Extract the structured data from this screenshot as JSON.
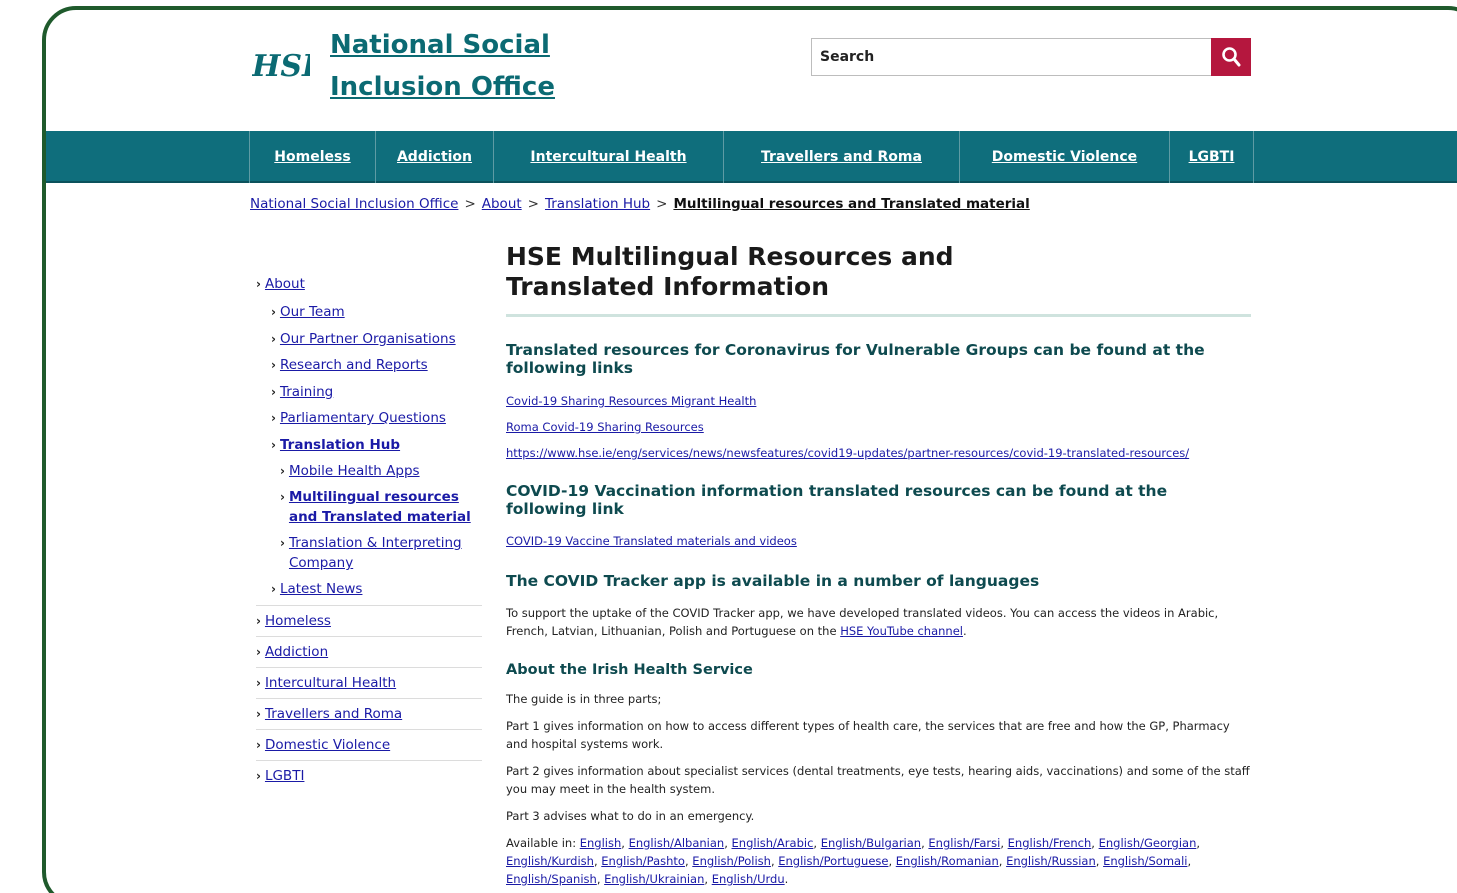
{
  "header": {
    "logo_text": "HSE",
    "site_title_line1": "National Social",
    "site_title_line2": "Inclusion Office",
    "search_placeholder": "Search",
    "search_icon": "search-icon"
  },
  "nav": [
    {
      "label": "Homeless"
    },
    {
      "label": "Addiction"
    },
    {
      "label": "Intercultural Health"
    },
    {
      "label": "Travellers and Roma"
    },
    {
      "label": "Domestic Violence"
    },
    {
      "label": "LGBTI"
    }
  ],
  "breadcrumb": {
    "items": [
      "National Social Inclusion Office",
      "About",
      "Translation Hub"
    ],
    "current": "Multilingual resources and Translated material",
    "separator": ">"
  },
  "sidebar": {
    "about": "About",
    "about_children": [
      "Our Team",
      "Our Partner Organisations",
      "Research and Reports",
      "Training",
      "Parliamentary Questions",
      "Translation Hub"
    ],
    "hub_children": [
      "Mobile Health Apps",
      "Multilingual resources and Translated material",
      "Translation & Interpreting Company"
    ],
    "latest_news": "Latest News",
    "main_items": [
      "Homeless",
      "Addiction",
      "Intercultural Health",
      "Travellers and Roma",
      "Domestic Violence",
      "LGBTI"
    ]
  },
  "content": {
    "title_line1": "HSE Multilingual Resources and",
    "title_line2": "Translated Information",
    "sec1_heading": "Translated resources for Coronavirus for Vulnerable Groups can be found at the following links",
    "sec1_links": [
      "Covid-19 Sharing Resources Migrant Health",
      "Roma Covid-19 Sharing Resources",
      "https://www.hse.ie/eng/services/news/newsfeatures/covid19-updates/partner-resources/covid-19-translated-resources/"
    ],
    "sec2_heading": "COVID-19 Vaccination information translated resources can be found at the following link",
    "sec2_link": "COVID-19 Vaccine Translated materials and videos",
    "sec3_heading": "The COVID Tracker app is available in a number of languages",
    "sec3_text": "To support the uptake of the COVID Tracker app, we have developed translated videos. You can access the videos in Arabic, French, Latvian, Lithuanian, Polish and Portuguese on the",
    "sec3_link": "HSE YouTube channel",
    "sec4_heading": "About the Irish Health Service",
    "sec4_p1": "The guide is in three parts;",
    "sec4_p2": "Part 1 gives information on how to access different types of health care, the services that are free and how the GP, Pharmacy and hospital systems work.",
    "sec4_p3": "Part 2 gives information about specialist services (dental treatments, eye tests, hearing aids, vaccinations) and some of the staff you may meet in the health system.",
    "sec4_p4": "Part 3 advises what to do in an emergency.",
    "available_label": "Available in:",
    "languages": [
      "English",
      "English/Albanian",
      "English/Arabic",
      "English/Bulgarian",
      "English/Farsi",
      "English/French",
      "English/Georgian",
      "English/Kurdish",
      "English/Pashto",
      "English/Polish",
      "English/Portuguese",
      "English/Romanian",
      "English/Russian",
      "English/Somali",
      "English/Spanish",
      "English/Ukrainian",
      "English/Urdu"
    ]
  },
  "colors": {
    "nav_bg": "#0f6e7c",
    "title_teal": "#0b6a73",
    "search_button": "#b5173e",
    "frame_border": "#1f5a2c"
  }
}
